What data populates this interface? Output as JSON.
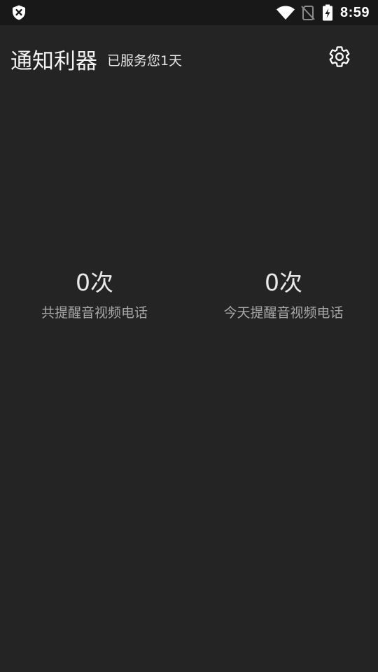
{
  "status_bar": {
    "time": "8:59",
    "icons": [
      "shield-x-icon",
      "wifi-icon",
      "no-sim-icon",
      "battery-charging-icon"
    ]
  },
  "header": {
    "title": "通知利器",
    "subtitle": "已服务您1天",
    "settings_icon": "gear-icon"
  },
  "stats": {
    "total": {
      "value": "0次",
      "label": "共提醒音视频电话"
    },
    "today": {
      "value": "0次",
      "label": "今天提醒音视频电话"
    }
  },
  "colors": {
    "background": "#242424",
    "status_bar": "#181818",
    "text_primary": "#e8e8e8",
    "text_secondary": "#a8a8a8"
  }
}
